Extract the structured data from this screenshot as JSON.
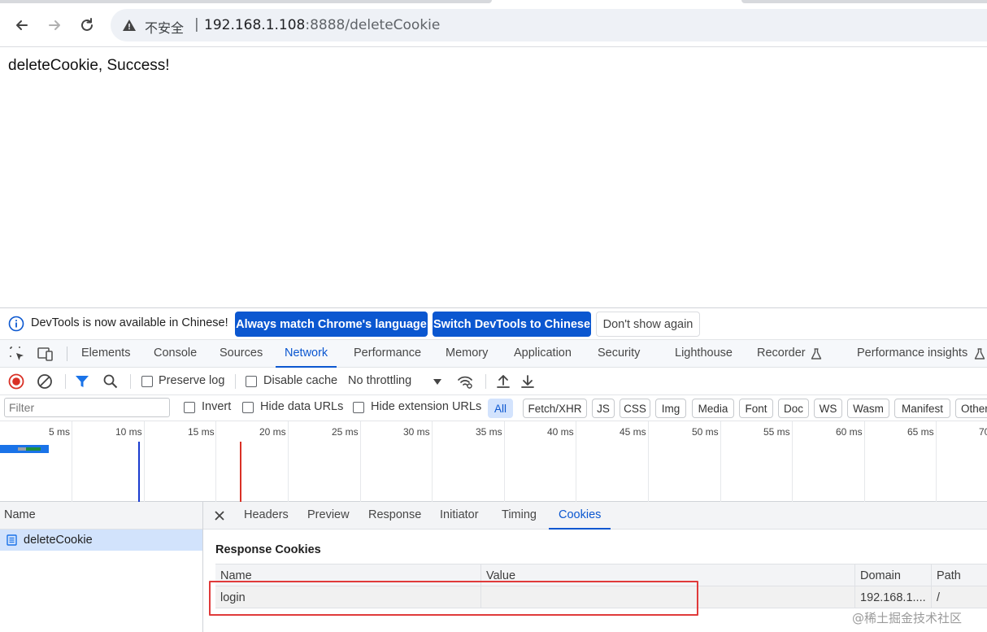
{
  "browser": {
    "security_label": "不安全",
    "separator": "|",
    "url_host": "192.168.1.108",
    "url_rest": ":8888/deleteCookie"
  },
  "page": {
    "body_text": "deleteCookie, Success!"
  },
  "devtools": {
    "infobar": {
      "message": "DevTools is now available in Chinese!",
      "btn_match": "Always match Chrome's language",
      "btn_switch": "Switch DevTools to Chinese",
      "btn_dismiss": "Don't show again"
    },
    "main_tabs": [
      "Elements",
      "Console",
      "Sources",
      "Network",
      "Performance",
      "Memory",
      "Application",
      "Security",
      "Lighthouse",
      "Recorder",
      "Performance insights"
    ],
    "active_main_tab": "Network",
    "network_toolbar": {
      "preserve_log": "Preserve log",
      "disable_cache": "Disable cache",
      "throttling": "No throttling"
    },
    "filter_row": {
      "filter_placeholder": "Filter",
      "invert": "Invert",
      "hide_data_urls": "Hide data URLs",
      "hide_extension_urls": "Hide extension URLs",
      "types": [
        "All",
        "Fetch/XHR",
        "JS",
        "CSS",
        "Img",
        "Media",
        "Font",
        "Doc",
        "WS",
        "Wasm",
        "Manifest",
        "Other"
      ],
      "active_type": "All"
    },
    "timeline_ticks": [
      "5 ms",
      "10 ms",
      "15 ms",
      "20 ms",
      "25 ms",
      "30 ms",
      "35 ms",
      "40 ms",
      "45 ms",
      "50 ms",
      "55 ms",
      "60 ms",
      "65 ms",
      "70"
    ],
    "request_list": {
      "header": "Name",
      "rows": [
        "deleteCookie"
      ]
    },
    "detail_tabs": [
      "Headers",
      "Preview",
      "Response",
      "Initiator",
      "Timing",
      "Cookies"
    ],
    "active_detail_tab": "Cookies",
    "cookies": {
      "section_title": "Response Cookies",
      "columns": [
        "Name",
        "Value",
        "Domain",
        "Path"
      ],
      "rows": [
        {
          "name": "login",
          "value": "",
          "domain": "192.168.1....",
          "path": "/"
        }
      ]
    }
  },
  "watermark": "@稀土掘金技术社区",
  "colors": {
    "accent": "#0b57d0",
    "highlight_box": "#e03a3a",
    "selected_row": "#d2e3fc"
  }
}
